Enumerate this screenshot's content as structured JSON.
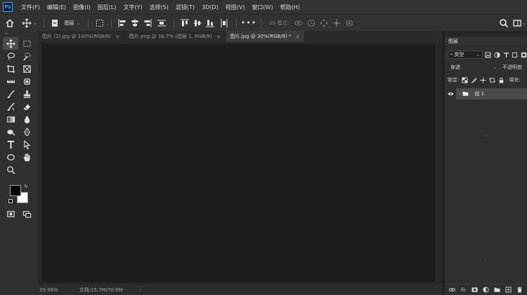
{
  "app": {
    "logo_text": "Ps"
  },
  "menu": [
    "文件(F)",
    "编辑(E)",
    "图像(I)",
    "图层(L)",
    "文字(Y)",
    "选择(S)",
    "滤镜(T)",
    "3D(D)",
    "视图(V)",
    "窗口(W)",
    "帮助(H)"
  ],
  "options_bar": {
    "layer_select_label": "图层",
    "mode_3d_label": "3D 模式:"
  },
  "tabs": [
    {
      "label": "图片 (1).jpg @ 100%(RGB/8)",
      "close": "×",
      "active": false
    },
    {
      "label": "图片.png @ 16.7% (图层 1, RGB/8)",
      "close": "×",
      "active": false
    },
    {
      "label": "图片.jpg @ 30%(RGB/8) *",
      "close": "×",
      "active": true
    }
  ],
  "status": {
    "zoom": "29.99%",
    "doc_size": "文档:15.7M/70.6M",
    "arrow": "›"
  },
  "layers_panel": {
    "title": "图层",
    "filter_label": "类型",
    "blend_mode": "穿透",
    "opacity_label": "不透明度",
    "lock_label": "锁定:",
    "fill_label": "填充:",
    "layer_name": "组 1",
    "bottom_fx": "fx"
  },
  "colors": {
    "accent": "#31a8ff",
    "foreground": "#000000",
    "background": "#ffffff"
  }
}
